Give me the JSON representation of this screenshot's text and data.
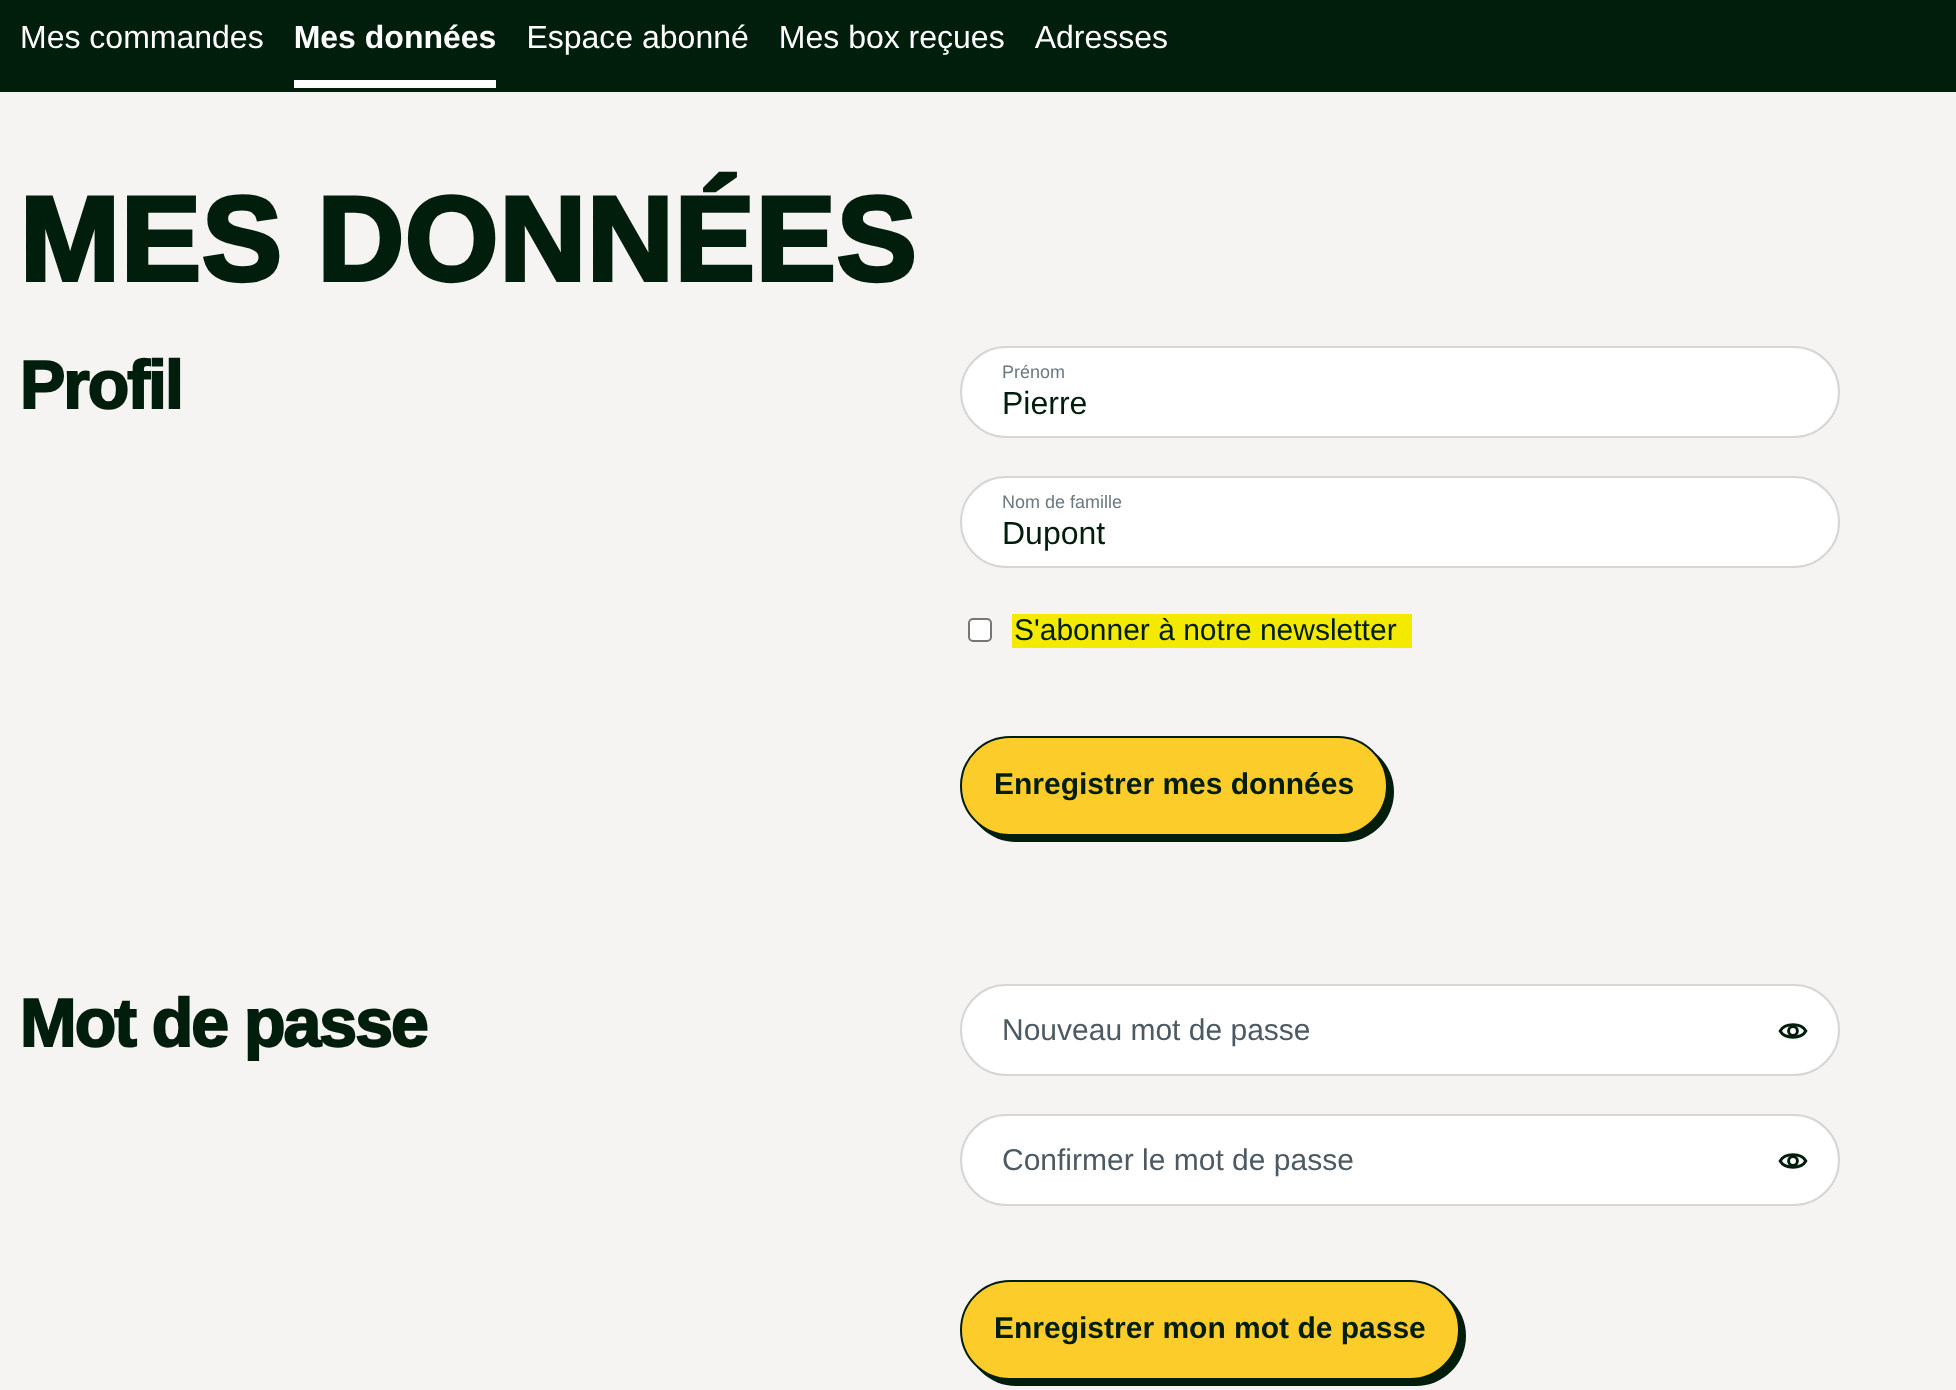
{
  "nav": {
    "tabs": [
      {
        "label": "Mes commandes",
        "selected": false
      },
      {
        "label": "Mes données",
        "selected": true
      },
      {
        "label": "Espace abonné",
        "selected": false
      },
      {
        "label": "Mes box reçues",
        "selected": false
      },
      {
        "label": "Adresses",
        "selected": false
      }
    ]
  },
  "page_title": "MES DONNÉES",
  "profile": {
    "heading": "Profil",
    "fields": [
      {
        "label": "Prénom",
        "value": "Pierre"
      },
      {
        "label": "Nom de famille",
        "value": "Dupont"
      }
    ],
    "newsletter": {
      "label": "S'abonner à notre newsletter",
      "checked": false,
      "highlighted": true
    },
    "button": "Enregistrer mes données"
  },
  "password": {
    "heading": "Mot de passe",
    "fields": [
      {
        "placeholder": "Nouveau mot de passe"
      },
      {
        "placeholder": "Confirmer le mot de passe"
      }
    ],
    "button": "Enregistrer mon mot de passe"
  }
}
